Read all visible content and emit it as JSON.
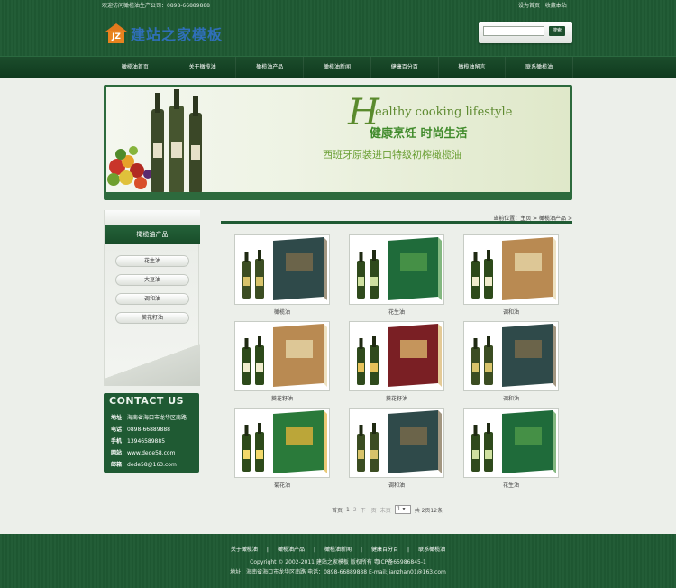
{
  "header": {
    "top_text": "欢迎访问橄榄油生产公司：0898-66889888",
    "top_links": "设为首页 · 收藏本站",
    "logo_badge": "JZ",
    "logo_text": "建站之家模板",
    "search_placeholder": "",
    "search_button": "搜索"
  },
  "nav": {
    "items": [
      "橄榄油首页",
      "关于橄榄油",
      "橄榄油产品",
      "橄榄油新闻",
      "健康百分百",
      "橄榄油留言",
      "联系橄榄油"
    ]
  },
  "banner": {
    "big_letter": "H",
    "english": "ealthy cooking lifestyle",
    "slogan": "健康烹饪 时尚生活",
    "subline": "西班牙原装进口特级初榨橄榄油"
  },
  "sidebar": {
    "title": "橄榄油产品",
    "categories": [
      "花生油",
      "大豆油",
      "调和油",
      "葵花籽油"
    ]
  },
  "contact": {
    "title": "CONTACT US",
    "lines": [
      {
        "label": "地址：",
        "value": "海南省海口市龙华区南路"
      },
      {
        "label": "电话：",
        "value": "0898-66889888"
      },
      {
        "label": "手机：",
        "value": "13946589885"
      },
      {
        "label": "网站：",
        "value": "www.dede58.com"
      },
      {
        "label": "邮箱：",
        "value": "dede58@163.com"
      }
    ]
  },
  "breadcrumb": "当前位置：主页 > 橄榄油产品 >",
  "products": [
    {
      "name": "橄榄油",
      "style": "dark"
    },
    {
      "name": "花生油",
      "style": "green"
    },
    {
      "name": "调和油",
      "style": "agrili"
    },
    {
      "name": "葵花籽油",
      "style": "agrili"
    },
    {
      "name": "葵花籽油",
      "style": "red"
    },
    {
      "name": "调和油",
      "style": "dark"
    },
    {
      "name": "菊花油",
      "style": "gold"
    },
    {
      "name": "调和油",
      "style": "dark"
    },
    {
      "name": "花生油",
      "style": "green"
    }
  ],
  "pager": {
    "first": "首页",
    "p1": "1",
    "p2": "2",
    "next": "下一页",
    "last": "末页",
    "select": "1",
    "summary": "共 2页12条"
  },
  "footer": {
    "links": [
      "关于橄榄油",
      "橄榄油产品",
      "橄榄油新闻",
      "健康百分百",
      "联系橄榄油"
    ],
    "copyright": "Copyright © 2002-2011 建站之家模板 版权所有 粤ICP备65986845-1",
    "address": "地址：海南省海口市龙华区南路 电话：0898-66889888 E-mail:jianzhan01@163.com"
  },
  "colors": {
    "brand_green": "#1f5a33",
    "logo_orange": "#e8831f",
    "logo_blue": "#2f6fb8"
  }
}
